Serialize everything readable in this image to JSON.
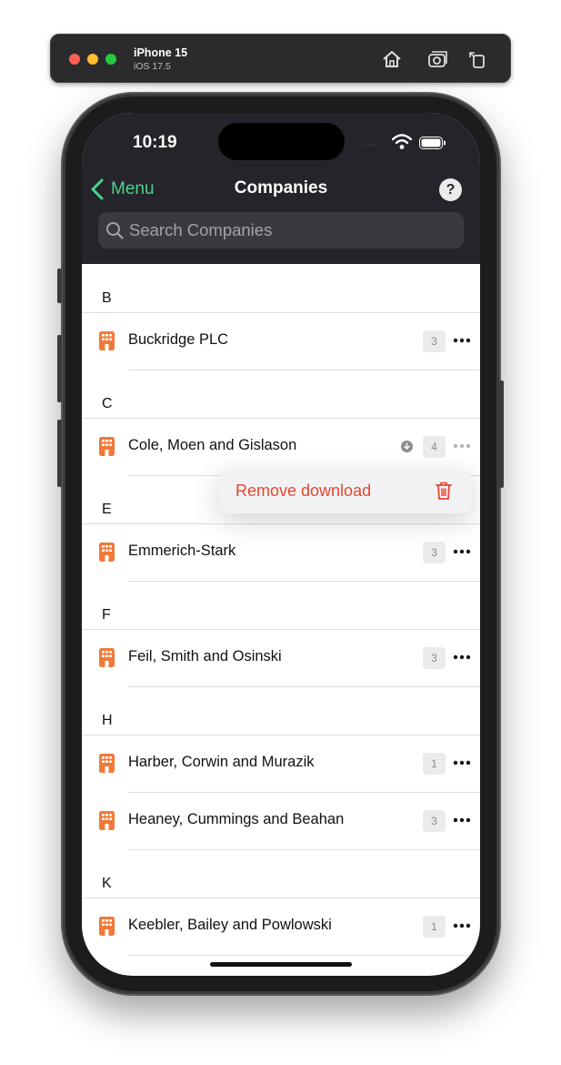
{
  "simulator": {
    "device_name": "iPhone 15",
    "os_version": "iOS 17.5",
    "icons": [
      "home-icon",
      "screenshot-icon",
      "rotate-icon"
    ]
  },
  "status_bar": {
    "time": "10:19",
    "signal": "....",
    "icons": [
      "wifi-icon",
      "battery-icon"
    ]
  },
  "nav": {
    "back_label": "Menu",
    "title": "Companies",
    "help_label": "?"
  },
  "search": {
    "placeholder": "Search Companies"
  },
  "sections": [
    {
      "letter": "B",
      "items": [
        {
          "name": "Buckridge PLC",
          "count": "3"
        }
      ]
    },
    {
      "letter": "C",
      "items": [
        {
          "name": "Cole, Moen and Gislason",
          "count": "4",
          "downloaded": true
        }
      ]
    },
    {
      "letter": "E",
      "items": [
        {
          "name": "Emmerich-Stark",
          "count": "3"
        }
      ]
    },
    {
      "letter": "F",
      "items": [
        {
          "name": "Feil, Smith and Osinski",
          "count": "3"
        }
      ]
    },
    {
      "letter": "H",
      "items": [
        {
          "name": "Harber, Corwin and Murazik",
          "count": "1"
        },
        {
          "name": "Heaney, Cummings and Beahan",
          "count": "3"
        }
      ]
    },
    {
      "letter": "K",
      "items": [
        {
          "name": "Keebler, Bailey and Powlowski",
          "count": "1"
        }
      ]
    }
  ],
  "context_menu": {
    "action_label": "Remove download",
    "icon": "trash-icon"
  },
  "colors": {
    "accent": "#4bd48b",
    "company_icon": "#f07a3a",
    "destructive": "#e8452f",
    "nav_background": "#25242a"
  }
}
